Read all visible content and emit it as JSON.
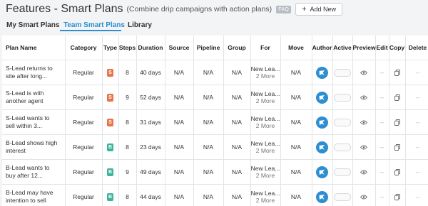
{
  "header": {
    "title": "Features - Smart Plans",
    "subtitle": "(Combine drip campaigns with action plans)",
    "faq": "FAQ",
    "add_label": "Add New",
    "add_icon": "plus-icon"
  },
  "tabs": [
    {
      "label": "My Smart Plans"
    },
    {
      "label": "Team Smart Plans"
    },
    {
      "label": "Library"
    }
  ],
  "active_tab": "Team Smart Plans",
  "colors": {
    "accent": "#2d8ed1",
    "badge_s": "#e8734b",
    "badge_b": "#3bb39d"
  },
  "table": {
    "columns": [
      "Plan Name",
      "Category",
      "Type",
      "Steps",
      "Duration",
      "Source",
      "Pipeline",
      "Group",
      "For",
      "Move",
      "Author",
      "Active",
      "Preview",
      "Edit",
      "Copy",
      "Delete"
    ],
    "rows": [
      {
        "name1": "S-Lead returns to",
        "name2": "site after long...",
        "category": "Regular",
        "type": "S",
        "steps": "8",
        "duration": "40 days",
        "source": "N/A",
        "pipeline": "N/A",
        "group": "N/A",
        "for1": "New Lea...",
        "for2": "2 More",
        "move": "N/A",
        "preview": "eye-icon",
        "edit": "--",
        "copy": "copy-icon",
        "delete": "--"
      },
      {
        "name1": "S-Lead is with",
        "name2": "another agent",
        "category": "Regular",
        "type": "S",
        "steps": "9",
        "duration": "52 days",
        "source": "N/A",
        "pipeline": "N/A",
        "group": "N/A",
        "for1": "New Lea...",
        "for2": "2 More",
        "move": "N/A",
        "preview": "eye-icon",
        "edit": "--",
        "copy": "copy-icon",
        "delete": "--"
      },
      {
        "name1": "S-Lead wants to",
        "name2": "sell within 3...",
        "category": "Regular",
        "type": "S",
        "steps": "8",
        "duration": "31 days",
        "source": "N/A",
        "pipeline": "N/A",
        "group": "N/A",
        "for1": "New Lea...",
        "for2": "2 More",
        "move": "N/A",
        "preview": "eye-icon",
        "edit": "--",
        "copy": "copy-icon",
        "delete": "--"
      },
      {
        "name1": "B-Lead shows high",
        "name2": "interest",
        "category": "Regular",
        "type": "B",
        "steps": "8",
        "duration": "23 days",
        "source": "N/A",
        "pipeline": "N/A",
        "group": "N/A",
        "for1": "New Lea...",
        "for2": "2 More",
        "move": "N/A",
        "preview": "eye-icon",
        "edit": "--",
        "copy": "copy-icon",
        "delete": "--"
      },
      {
        "name1": "B-Lead wants to",
        "name2": "buy after 12...",
        "category": "Regular",
        "type": "B",
        "steps": "9",
        "duration": "49 days",
        "source": "N/A",
        "pipeline": "N/A",
        "group": "N/A",
        "for1": "New Lea...",
        "for2": "2 More",
        "move": "N/A",
        "preview": "eye-icon",
        "edit": "--",
        "copy": "copy-icon",
        "delete": "--"
      },
      {
        "name1": "B-Lead may have",
        "name2": "intention to sell",
        "category": "Regular",
        "type": "B",
        "steps": "8",
        "duration": "44 days",
        "source": "N/A",
        "pipeline": "N/A",
        "group": "N/A",
        "for1": "New Lea...",
        "for2": "2 More",
        "move": "N/A",
        "preview": "eye-icon",
        "edit": "--",
        "copy": "copy-icon",
        "delete": "--"
      }
    ]
  }
}
